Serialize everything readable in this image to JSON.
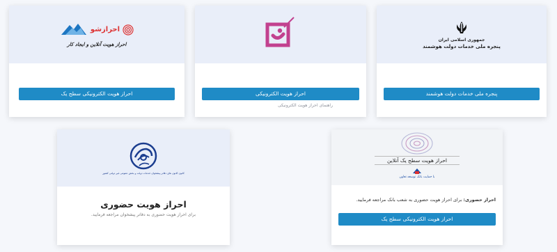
{
  "cards": {
    "smart": {
      "logo_line1": "جمهوری اسلامی ایران",
      "logo_line2": "پنجره ملی خدمات دولت هوشمند",
      "button": "پنجره ملی خدمات دولت هوشمند"
    },
    "electronic": {
      "button": "احراز هویت الکترونیکی",
      "hint": "راهنمای احراز هویت الکترونیکی"
    },
    "level1": {
      "logo_brand": "احرازشو",
      "logo_caption": "احراز هویت آنلاین و ایجاد کار",
      "button": "احراز هویت الکترونیکی سطح یک"
    },
    "online": {
      "banner_title": "احراز هویت سطح یک آنلاین",
      "bank_caption": "با حمایت بانک توسعه تعاون",
      "desc_bold": "احراز حضوری:",
      "desc": " برای احراز هویت حضوری به شعب بانک مراجعه فرمایید.",
      "button": "احراز هویت الکترونیکی سطح یک"
    },
    "inperson": {
      "logo_caption": "کانون کانون های دفاتر پیشخوان خدمات دولت و بخش عمومی غیر دولتی کشور",
      "title": "احراز هویت حضوری",
      "desc": "برای احراز هویت حضوری به دفاتر پیشخوان مراجعه فرمایید."
    }
  },
  "colors": {
    "button": "#1f8bc6",
    "card_top": "#e9eef9",
    "electronic_logo": "#c2418f"
  }
}
